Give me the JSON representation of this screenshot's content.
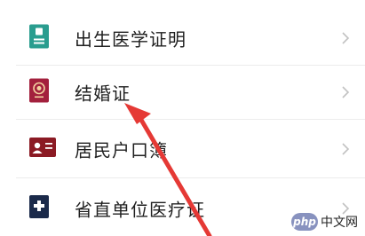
{
  "certificates": [
    {
      "label": "出生医学证明",
      "icon": "birth-certificate-icon",
      "icon_color": "#2a9d8f"
    },
    {
      "label": "结婚证",
      "icon": "marriage-certificate-icon",
      "icon_color": "#a3203d"
    },
    {
      "label": "居民户口簿",
      "icon": "household-register-icon",
      "icon_color": "#8b1a24"
    },
    {
      "label": "省直单位医疗证",
      "icon": "medical-card-icon",
      "icon_color": "#1b2a4a"
    }
  ],
  "watermark": {
    "badge": "php",
    "text": "中文网"
  },
  "colors": {
    "arrow": "#e53935",
    "chevron": "#c2c2c2"
  }
}
